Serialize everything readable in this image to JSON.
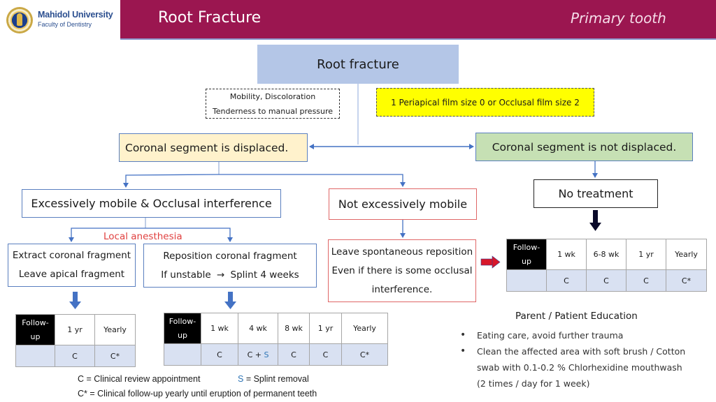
{
  "header": {
    "logo_name": "Mahidol University",
    "logo_sub": "Faculty of Dentistry",
    "title": "Root Fracture",
    "subtitle": "Primary tooth",
    "bar_color": "#9b1650"
  },
  "flow": {
    "root": "Root fracture",
    "signs": [
      "Mobility, Discoloration",
      "Tenderness to manual pressure"
    ],
    "radiograph": "1 Periapical film size 0 or Occlusal film size 2",
    "displaced": "Coronal segment is displaced.",
    "not_displaced": "Coronal segment is not displaced.",
    "excessively_mobile": "Excessively mobile & Occlusal interference",
    "not_excessively_mobile": "Not excessively mobile",
    "no_treatment": "No treatment",
    "local_anesthesia": "Local anesthesia",
    "extract": [
      "Extract coronal fragment",
      "Leave apical fragment"
    ],
    "reposition": [
      "Reposition coronal fragment",
      "If unstable",
      "→",
      "Splint 4 weeks"
    ],
    "leave_spontaneous": [
      "Leave spontaneous reposition",
      "Even if there is some occlusal",
      "interference."
    ]
  },
  "tables": {
    "extract_followup": {
      "label": "Follow-up",
      "headers": [
        "1 yr",
        "Yearly"
      ],
      "values": [
        "C",
        "C*"
      ]
    },
    "reposition_followup": {
      "label": "Follow-up",
      "headers": [
        "1 wk",
        "4 wk",
        "8 wk",
        "1 yr",
        "Yearly"
      ],
      "values": [
        "C",
        "C + S",
        "C",
        "C",
        "C*"
      ]
    },
    "no_treatment_followup": {
      "label": "Follow-up",
      "headers": [
        "1 wk",
        "6-8 wk",
        "1 yr",
        "Yearly"
      ],
      "values": [
        "C",
        "C",
        "C",
        "C*"
      ]
    }
  },
  "legend": {
    "c": "C =  Clinical review appointment",
    "s_symbol": "S",
    "s_text": " = Splint removal",
    "c_star": "C* = Clinical follow-up yearly until eruption of permanent teeth"
  },
  "education": {
    "title": "Parent / Patient Education",
    "items": [
      "Eating care, avoid further trauma",
      "Clean the affected area with soft brush / Cotton"
    ],
    "continuation": [
      "swab with 0.1-0.2 % Chlorhexidine mouthwash",
      "(2 times / day for 1 week)"
    ]
  },
  "colors": {
    "root_box": "#b4c6e7",
    "displaced_box": "#fff2cc",
    "not_displaced_box": "#c6e0b4",
    "radiograph_box": "#ffff00",
    "anesthesia_text": "#e0403f",
    "splint_text": "#2e75b6"
  }
}
